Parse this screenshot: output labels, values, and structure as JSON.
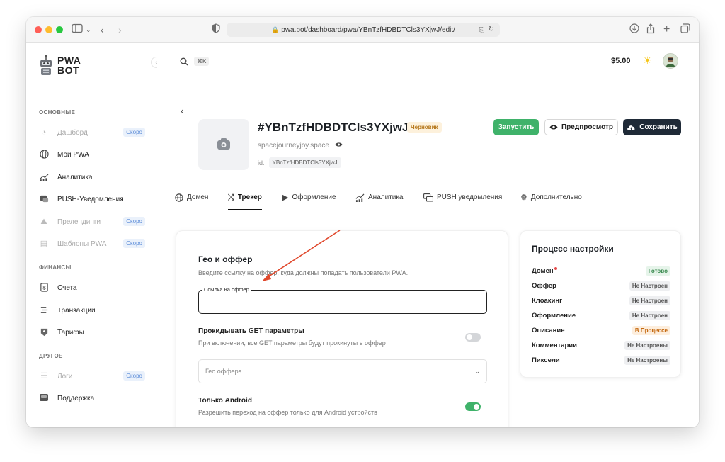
{
  "browser": {
    "url": "pwa.bot/dashboard/pwa/YBnTzfHDBDTCls3YXjwJ/edit/"
  },
  "sidebar": {
    "logo_line1": "PWA",
    "logo_line2": "BOT",
    "sections": {
      "main": "ОСНОВНЫЕ",
      "finance": "ФИНАНСЫ",
      "other": "ДРУГОЕ"
    },
    "items": [
      {
        "label": "Дашборд",
        "badge": "Скоро",
        "icon": "dashboard-icon"
      },
      {
        "label": "Мои PWA",
        "icon": "globe-icon"
      },
      {
        "label": "Аналитика",
        "icon": "analytics-icon"
      },
      {
        "label": "PUSH-Уведомления",
        "icon": "push-icon"
      },
      {
        "label": "Прелендинги",
        "badge": "Скоро",
        "icon": "prelanding-icon"
      },
      {
        "label": "Шаблоны PWA",
        "badge": "Скоро",
        "icon": "template-icon"
      },
      {
        "label": "Счета",
        "icon": "invoice-icon"
      },
      {
        "label": "Транзакции",
        "icon": "transactions-icon"
      },
      {
        "label": "Тарифы",
        "icon": "tariffs-icon"
      },
      {
        "label": "Логи",
        "badge": "Скоро",
        "icon": "logs-icon"
      },
      {
        "label": "Поддержка",
        "icon": "support-icon"
      }
    ]
  },
  "header": {
    "search_shortcut": "⌘K",
    "balance": "$5.00"
  },
  "pwa": {
    "title": "#YBnTzfHDBDTCls3YXjwJ",
    "status": "Черновик",
    "domain": "spacejourneyjoy.space",
    "id_label": "id:",
    "id_value": "YBnTzfHDBDTCls3YXjwJ"
  },
  "actions": {
    "run": "Запустить",
    "preview": "Предпросмотр",
    "save": "Сохранить"
  },
  "tabs": [
    {
      "label": "Домен",
      "icon": "globe-icon"
    },
    {
      "label": "Трекер",
      "icon": "shuffle-icon",
      "active": true
    },
    {
      "label": "Оформление",
      "icon": "design-icon"
    },
    {
      "label": "Аналитика",
      "icon": "analytics-icon"
    },
    {
      "label": "PUSH уведомления",
      "icon": "chat-icon"
    },
    {
      "label": "Дополнительно",
      "icon": "gear-icon"
    }
  ],
  "form": {
    "title": "Гео и оффер",
    "subtitle": "Введите ссылку на оффер, куда должны попадать пользователи PWA.",
    "offer_link_label": "Ссылка на оффер",
    "offer_link_value": "",
    "get_params_title": "Прокидывать GET параметры",
    "get_params_desc": "При включении, все GET параметры будут прокинуты в оффер",
    "get_params_enabled": false,
    "geo_placeholder": "Гео оффера",
    "android_title": "Только Android",
    "android_desc": "Разрешить переход на оффер только для Android устройств",
    "android_enabled": true
  },
  "process": {
    "title": "Процесс настройки",
    "rows": [
      {
        "label": "Домен",
        "status": "Готово",
        "kind": "ok"
      },
      {
        "label": "Оффер",
        "status": "Не Настроен",
        "kind": "no"
      },
      {
        "label": "Клоакинг",
        "status": "Не Настроен",
        "kind": "no"
      },
      {
        "label": "Оформление",
        "status": "Не Настроен",
        "kind": "no"
      },
      {
        "label": "Описание",
        "status": "В Процессе",
        "kind": "prog"
      },
      {
        "label": "Комментарии",
        "status": "Не Настроены",
        "kind": "no"
      },
      {
        "label": "Пиксели",
        "status": "Не Настроены",
        "kind": "no"
      }
    ]
  },
  "colors": {
    "accent_green": "#3fb26a",
    "dark_button": "#1f2a37",
    "annotation_arrow": "#e0482c"
  }
}
